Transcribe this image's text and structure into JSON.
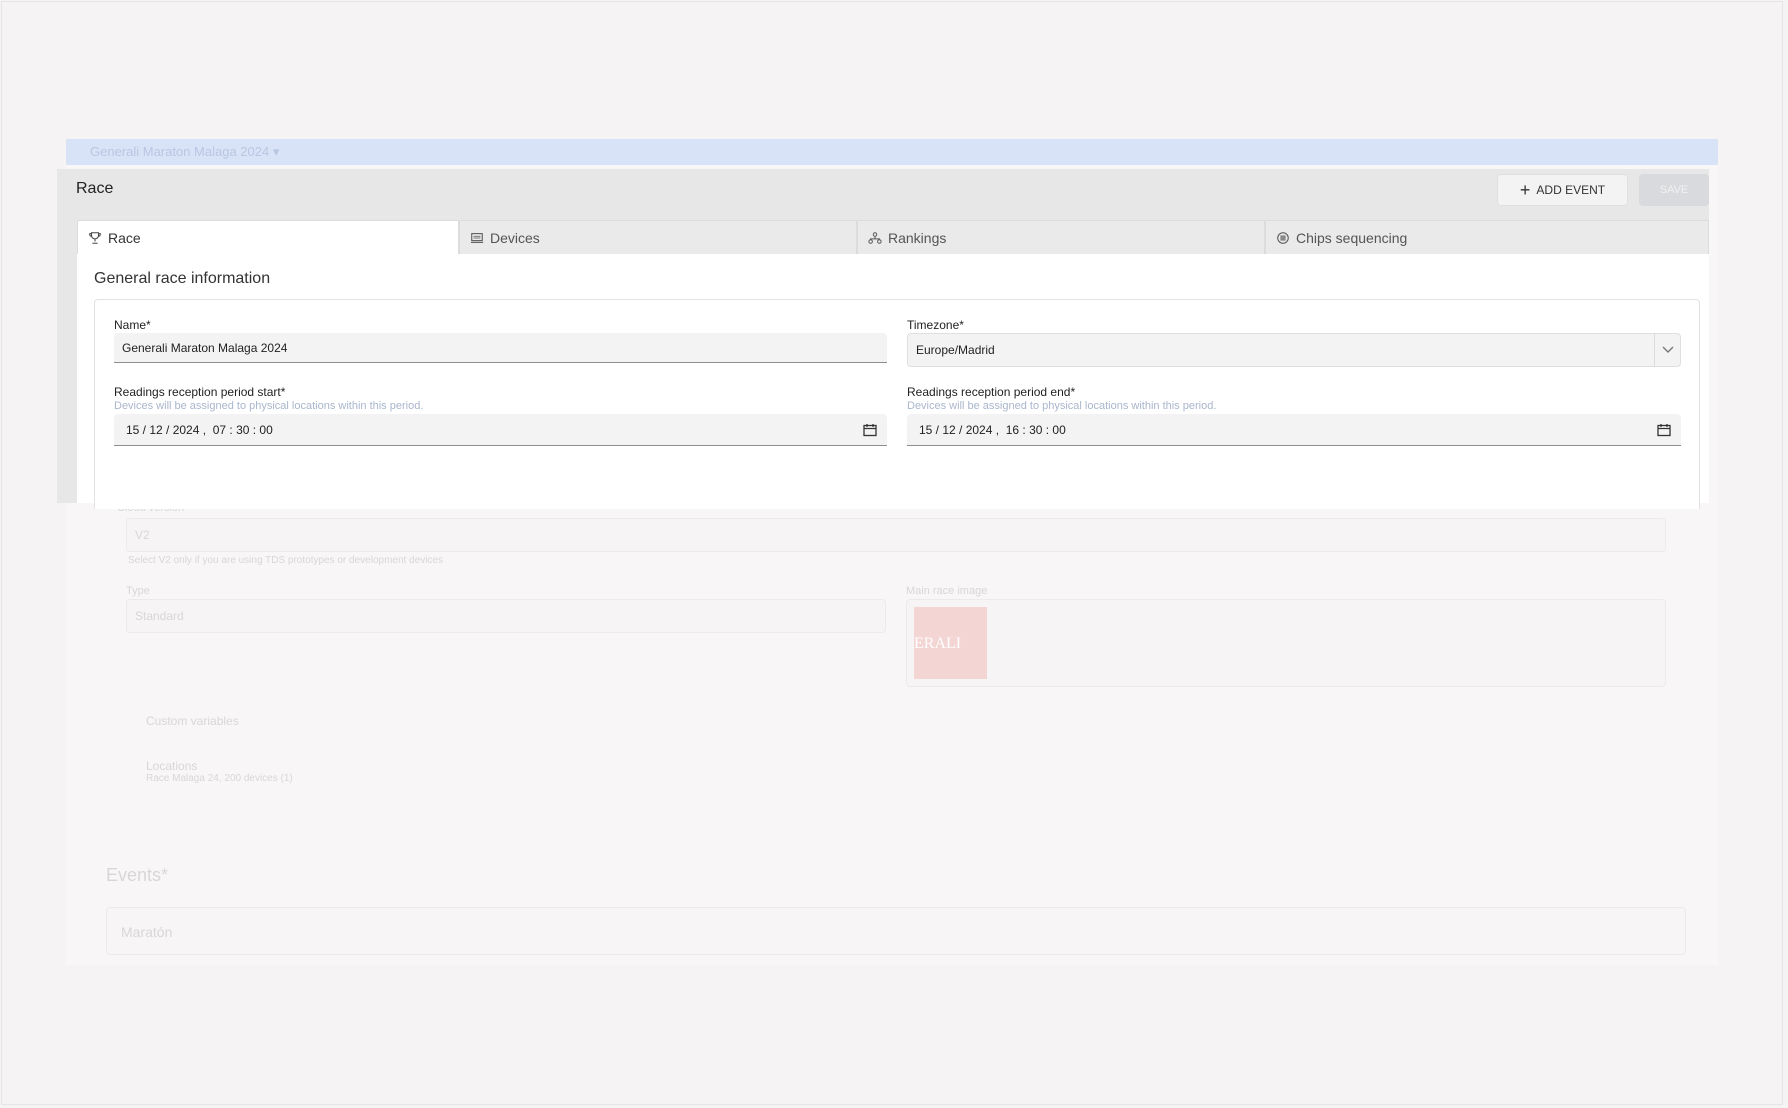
{
  "background": {
    "race_selector": "Generali Maraton Malaga 2024",
    "cloud_version_label": "Cloud version",
    "cloud_version_value": "V2",
    "cloud_warning": "Select V2 only if you are using TDS prototypes or development devices",
    "type_label": "Type",
    "type_value": "Standard",
    "main_image_label": "Main race image",
    "image_text": "ERALI",
    "custom_variables": "Custom variables",
    "locations": "Locations",
    "locations_sub": "Race Malaga 24, 200 devices (1)",
    "events_title": "Events*",
    "event_item": "Maratón"
  },
  "modal": {
    "title": "Race",
    "add_event_label": "ADD EVENT",
    "save_label": "SAVE",
    "tabs": [
      {
        "label": "Race",
        "icon": "trophy-icon"
      },
      {
        "label": "Devices",
        "icon": "device-icon"
      },
      {
        "label": "Rankings",
        "icon": "ranking-icon"
      },
      {
        "label": "Chips sequencing",
        "icon": "chip-icon"
      }
    ],
    "section_title": "General race information",
    "fields": {
      "name_label": "Name*",
      "name_value": "Generali Maraton Malaga 2024",
      "timezone_label": "Timezone*",
      "timezone_value": "Europe/Madrid",
      "start_label": "Readings reception period start*",
      "start_hint": "Devices will be assigned to physical locations within this period.",
      "start_value": "15 / 12 / 2024 ,  07 : 30 : 00",
      "end_label": "Readings reception period end*",
      "end_hint": "Devices will be assigned to physical locations within this period.",
      "end_value": "15 / 12 / 2024 ,  16 : 30 : 00"
    }
  },
  "colors": {
    "race_bar": "#d9e3f7",
    "hint": "#a9b6cc",
    "save_disabled": "#d9dadd"
  }
}
